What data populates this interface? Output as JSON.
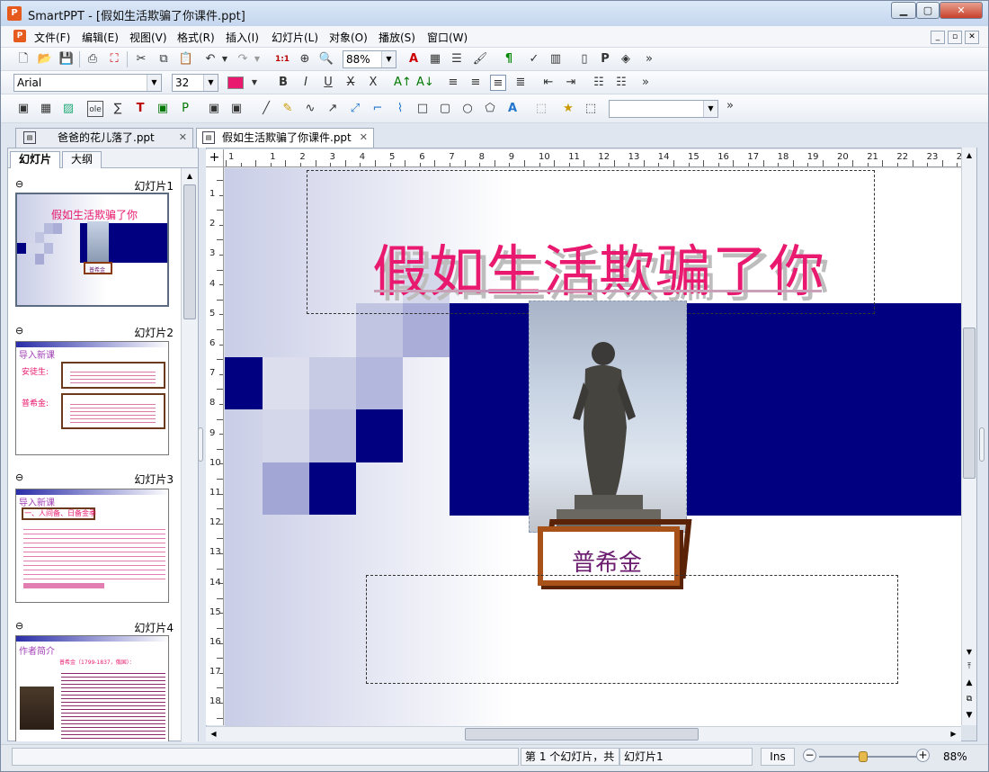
{
  "window": {
    "app": "SmartPPT",
    "title": "SmartPPT - [假如生活欺骗了你课件.ppt]"
  },
  "menu": [
    "文件(F)",
    "编辑(E)",
    "视图(V)",
    "格式(R)",
    "插入(I)",
    "幻灯片(L)",
    "对象(O)",
    "播放(S)",
    "窗口(W)"
  ],
  "toolbar": {
    "zoom": "88%",
    "font_name": "Arial",
    "font_size": "32",
    "more": "»",
    "ole_label": "ole"
  },
  "doc_tabs": [
    {
      "label": "爸爸的花儿落了.ppt",
      "active": false
    },
    {
      "label": "假如生活欺骗了你课件.ppt",
      "active": true
    }
  ],
  "pane_tabs": [
    "幻灯片",
    "大纲"
  ],
  "slides": [
    {
      "label": "幻灯片1",
      "title": "假如生活欺骗了你",
      "caption": "普希金"
    },
    {
      "label": "幻灯片2",
      "heading": "导入新课",
      "line1": "安徒生:",
      "line2": "普希金:"
    },
    {
      "label": "幻灯片3",
      "heading": "导入新课",
      "sub": "一、人间备、日备金季"
    },
    {
      "label": "幻灯片4",
      "heading": "作者简介",
      "line1": "普希金（1799-1837，俄国）："
    }
  ],
  "slide_main": {
    "title": "假如生活欺骗了你",
    "caption": "普希金"
  },
  "ruler_h": [
    "1",
    "1",
    "2",
    "3",
    "4",
    "5",
    "6",
    "7",
    "8",
    "9",
    "10",
    "11",
    "12",
    "13",
    "14",
    "15",
    "16",
    "17",
    "18",
    "19",
    "20",
    "21",
    "22",
    "23",
    "24"
  ],
  "ruler_v": [
    "1",
    "2",
    "3",
    "4",
    "5",
    "6",
    "7",
    "8",
    "9",
    "10",
    "11",
    "12",
    "13",
    "14",
    "15",
    "16",
    "17",
    "18"
  ],
  "status": {
    "position": "第 1 个幻灯片，共",
    "slide_name": "幻灯片1",
    "mode": "Ins",
    "zoom": "88%"
  },
  "colors": {
    "navy": "#000080",
    "title_pink": "#e8196e",
    "caption_purple": "#6a1b6e",
    "frame_brown": "#8a3a0a"
  }
}
